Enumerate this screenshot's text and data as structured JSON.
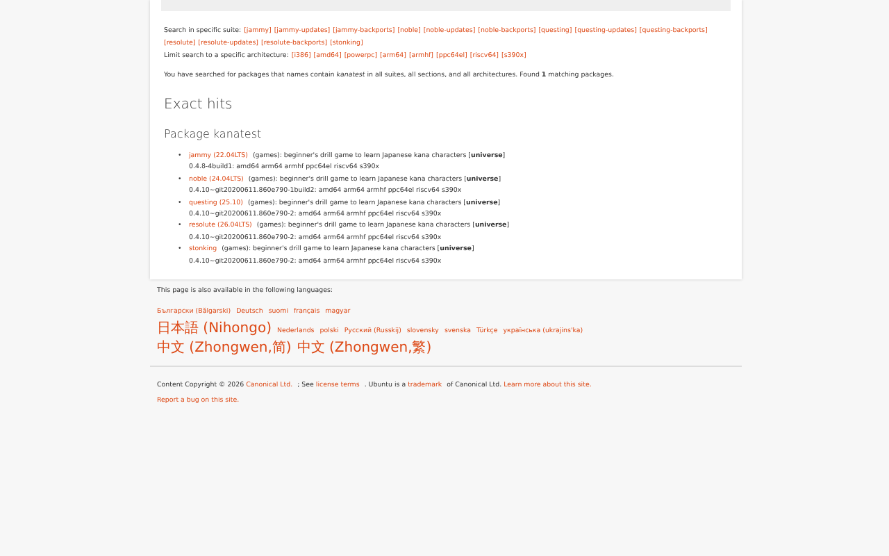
{
  "suite_filter": {
    "label": "Search in specific suite:",
    "links": [
      "[jammy]",
      "[jammy-updates]",
      "[jammy-backports]",
      "[noble]",
      "[noble-updates]",
      "[noble-backports]",
      "[questing]",
      "[questing-updates]",
      "[questing-backports]",
      "[resolute]",
      "[resolute-updates]",
      "[resolute-backports]",
      "[stonking]"
    ]
  },
  "arch_filter": {
    "label": "Limit search to a specific architecture:",
    "links": [
      "[i386]",
      "[amd64]",
      "[powerpc]",
      "[arm64]",
      "[armhf]",
      "[ppc64el]",
      "[riscv64]",
      "[s390x]"
    ]
  },
  "summary": "You have searched for packages that names contain *kanatest* in all suites, all sections, and all architectures. Found **1** matching packages.",
  "heading": "Exact hits",
  "package_heading": "Package kanatest",
  "results": [
    {
      "marker": "•",
      "suite": "jammy (22.04LTS)",
      "description": "(games): beginner's drill game to learn Japanese kana characters [**universe**]",
      "versions": "0.4.8-4build1: amd64 arm64 armhf ppc64el riscv64 s390x"
    },
    {
      "marker": "•",
      "suite": "noble (24.04LTS)",
      "description": "(games): beginner's drill game to learn Japanese kana characters [**universe**]",
      "versions": "0.4.10~git20200611.860e790-1build2: amd64 arm64 armhf ppc64el riscv64 s390x"
    },
    {
      "marker": "•",
      "suite": "questing (25.10)",
      "description": "(games): beginner's drill game to learn Japanese kana characters [**universe**]",
      "versions": "0.4.10~git20200611.860e790-2: amd64 arm64 armhf ppc64el riscv64 s390x"
    },
    {
      "marker": "•",
      "suite": "resolute (26.04LTS)",
      "description": "(games): beginner's drill game to learn Japanese kana characters [**universe**]",
      "versions": "0.4.10~git20200611.860e790-2: amd64 arm64 armhf ppc64el riscv64 s390x"
    },
    {
      "marker": "•",
      "suite": "stonking",
      "description": "(games): beginner's drill game to learn Japanese kana characters [**universe**]",
      "versions": "0.4.10~git20200611.860e790-2: amd64 arm64 armhf ppc64el riscv64 s390x"
    }
  ],
  "languages": {
    "intro": "This page is also available in the following languages:",
    "links": [
      {
        "kind": "latin",
        "text": "Български (Bălgarski)"
      },
      {
        "kind": "latin",
        "text": "Deutsch"
      },
      {
        "kind": "latin",
        "text": "suomi"
      },
      {
        "kind": "latin",
        "text": "français"
      },
      {
        "kind": "latin",
        "text": "magyar"
      },
      {
        "kind": "cjk",
        "text": "日本語 (Nihongo)"
      },
      {
        "kind": "latin",
        "text": "Nederlands"
      },
      {
        "kind": "latin",
        "text": "polski"
      },
      {
        "kind": "latin",
        "text": "Русский (Russkij)"
      },
      {
        "kind": "latin",
        "text": "slovensky"
      },
      {
        "kind": "latin",
        "text": "svenska"
      },
      {
        "kind": "latin",
        "text": "Türkçe"
      },
      {
        "kind": "latin",
        "text": "українська (ukrajins'ka)"
      },
      {
        "kind": "cjk",
        "text": "中文 (Zhongwen,简)"
      },
      {
        "kind": "cjk",
        "text": "中文 (Zhongwen,繁)"
      }
    ]
  },
  "copyright": [
    {
      "kind": "text",
      "text": "Content Copyright © 2026"
    },
    {
      "kind": "link",
      "text": "Canonical Ltd."
    },
    {
      "kind": "text",
      "text": "; See"
    },
    {
      "kind": "link",
      "text": "license terms"
    },
    {
      "kind": "text",
      "text": ". Ubuntu is a"
    },
    {
      "kind": "link",
      "text": "trademark"
    },
    {
      "kind": "text",
      "text": "of Canonical Ltd."
    },
    {
      "kind": "link",
      "text": "Learn more about this site."
    }
  ],
  "bug_link": "Report a bug on this site."
}
